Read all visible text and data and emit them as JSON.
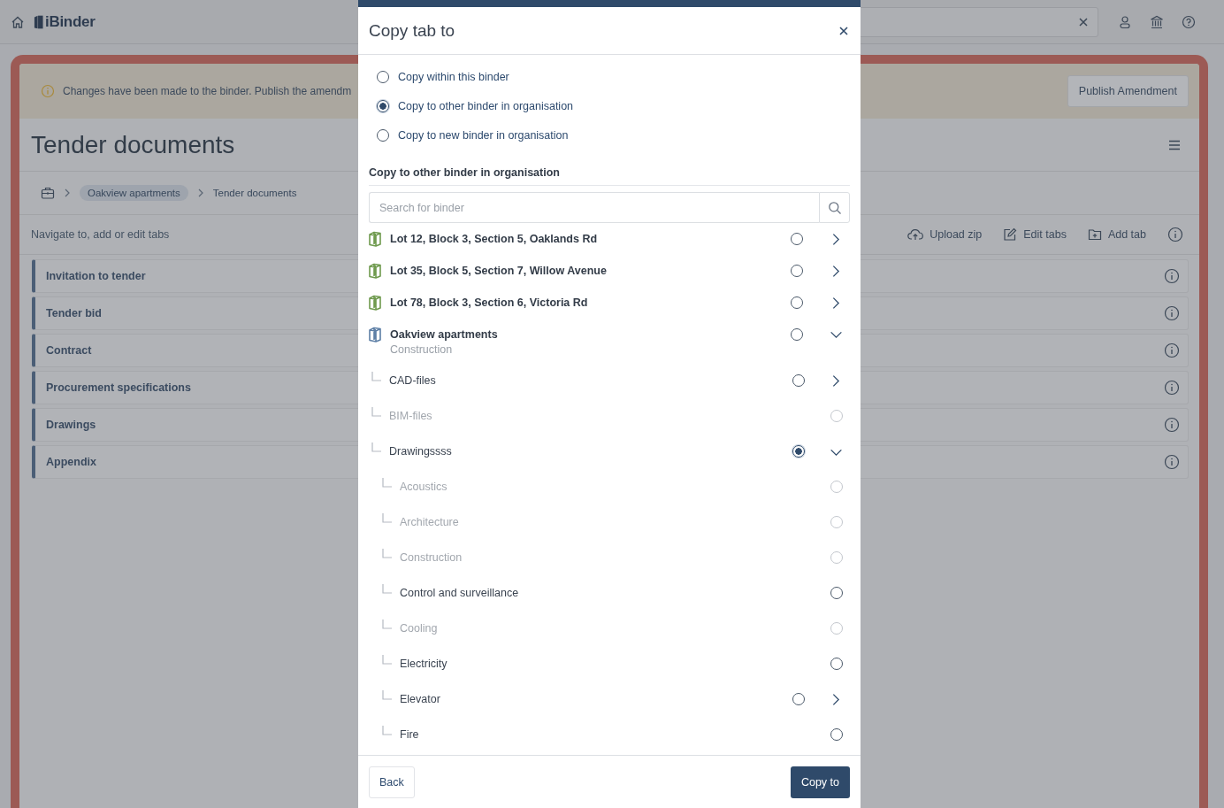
{
  "topbar": {
    "logo": "iBinder"
  },
  "banner": {
    "message": "Changes have been made to the binder. Publish the amendm",
    "button": "Publish Amendment"
  },
  "page": {
    "title": "Tender documents",
    "breadcrumbs": [
      {
        "label": "Oakview apartments",
        "kind": "chip"
      },
      {
        "label": "Tender documents",
        "kind": "plain"
      }
    ],
    "hint": "Navigate to, add or edit tabs",
    "actions": [
      {
        "label": "Upload zip",
        "kind": "upload"
      },
      {
        "label": "Edit tabs",
        "kind": "edit"
      },
      {
        "label": "Add tab",
        "kind": "add"
      }
    ]
  },
  "tabs": [
    "Invitation to tender",
    "Tender bid",
    "Contract",
    "Procurement specifications",
    "Drawings",
    "Appendix"
  ],
  "dialog": {
    "title": "Copy tab to",
    "options": [
      {
        "label": "Copy within this binder",
        "selected": false
      },
      {
        "label": "Copy to other binder in organisation",
        "selected": true
      },
      {
        "label": "Copy to new binder in organisation",
        "selected": false
      }
    ],
    "section_title": "Copy to other binder in organisation",
    "search": {
      "placeholder": "Search for binder"
    },
    "binders": [
      {
        "name": "Lot 12, Block 3, Section 5, Oaklands Rd",
        "color": "#6f9a4e",
        "selected": false,
        "expanded": false
      },
      {
        "name": "Lot 35, Block 5, Section 7, Willow Avenue",
        "color": "#6f9a4e",
        "selected": false,
        "expanded": false
      },
      {
        "name": "Lot 78, Block 3, Section 6, Victoria Rd",
        "color": "#6f9a4e",
        "selected": false,
        "expanded": false
      },
      {
        "name": "Oakview apartments",
        "subtitle": "Construction",
        "color": "#5d7fa6",
        "selected": false,
        "expanded": true,
        "children": [
          {
            "name": "CAD-files",
            "selected": false,
            "disabled": false,
            "expanded": false
          },
          {
            "name": "BIM-files",
            "selected": false,
            "disabled": true
          },
          {
            "name": "Drawingssss",
            "selected": true,
            "disabled": false,
            "expanded": true,
            "children": [
              {
                "name": "Acoustics",
                "selected": false,
                "disabled": true
              },
              {
                "name": "Architecture",
                "selected": false,
                "disabled": true
              },
              {
                "name": "Construction",
                "selected": false,
                "disabled": true
              },
              {
                "name": "Control and surveillance",
                "selected": false,
                "disabled": false
              },
              {
                "name": "Cooling",
                "selected": false,
                "disabled": true
              },
              {
                "name": "Electricity",
                "selected": false,
                "disabled": false
              },
              {
                "name": "Elevator",
                "selected": false,
                "disabled": false,
                "expanded": false
              },
              {
                "name": "Fire",
                "selected": false,
                "disabled": false
              }
            ]
          }
        ]
      }
    ],
    "buttons": {
      "back": "Back",
      "confirm": "Copy to"
    }
  }
}
